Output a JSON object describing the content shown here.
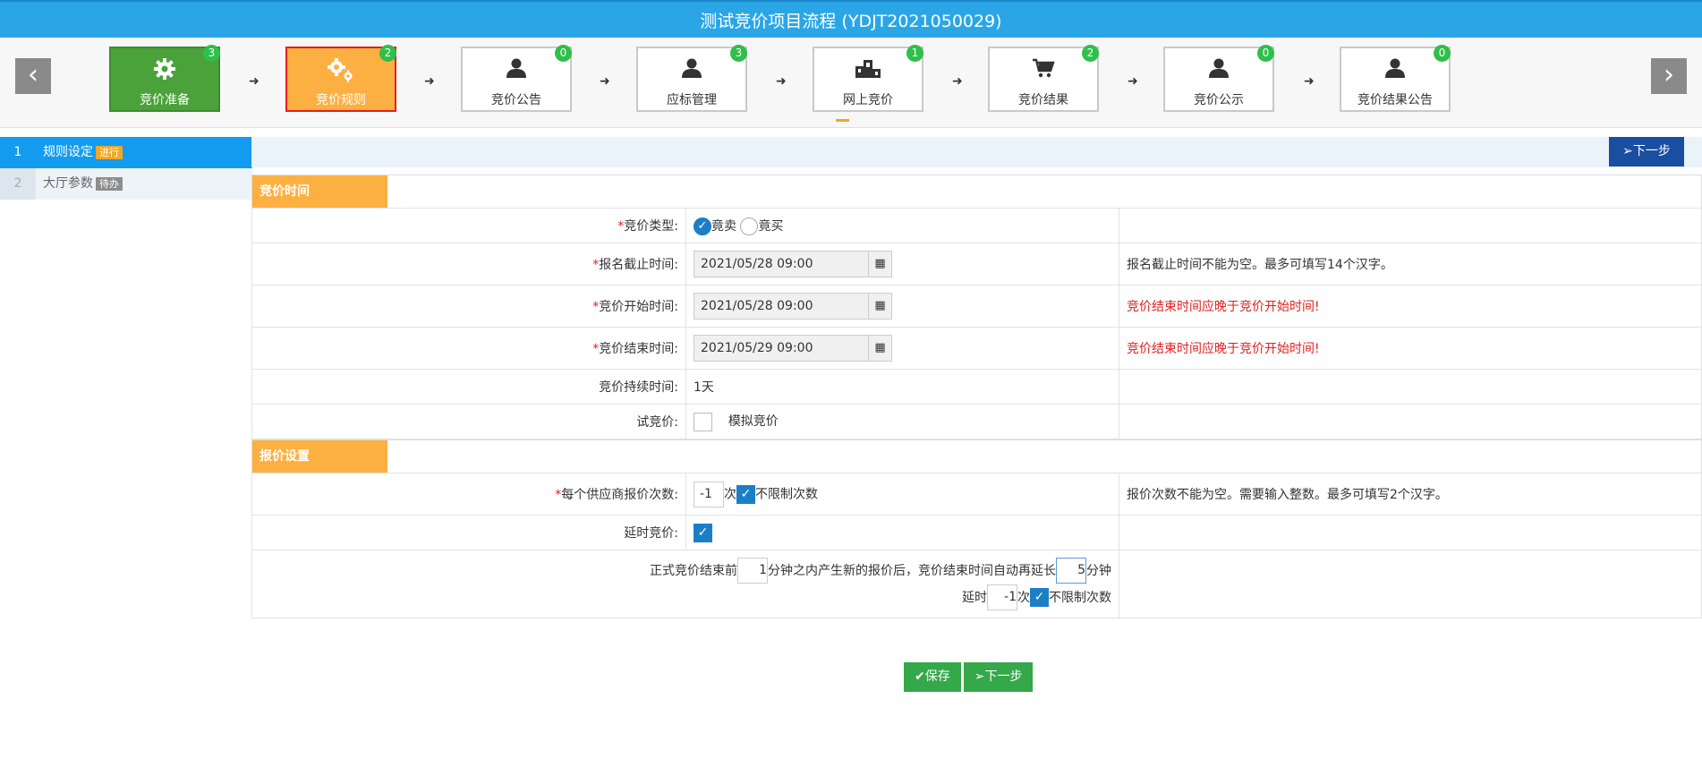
{
  "header": {
    "title": "测试竞价项目流程 (YDJT2021050029)"
  },
  "steps": [
    {
      "label": "竞价准备",
      "count": "3",
      "icon": "gear-icon",
      "state": "done"
    },
    {
      "label": "竞价规则",
      "count": "2",
      "icon": "gears-icon",
      "state": "active"
    },
    {
      "label": "竞价公告",
      "count": "0",
      "icon": "user-icon",
      "state": "normal"
    },
    {
      "label": "应标管理",
      "count": "3",
      "icon": "user-icon",
      "state": "normal"
    },
    {
      "label": "网上竞价",
      "count": "1",
      "icon": "podium-icon",
      "state": "normal"
    },
    {
      "label": "竞价结果",
      "count": "2",
      "icon": "cart-icon",
      "state": "normal"
    },
    {
      "label": "竞价公示",
      "count": "0",
      "icon": "user-icon",
      "state": "normal"
    },
    {
      "label": "竞价结果公告",
      "count": "0",
      "icon": "user-icon",
      "state": "normal"
    }
  ],
  "sidenav": [
    {
      "num": "1",
      "label": "规则设定",
      "tag": "进行"
    },
    {
      "num": "2",
      "label": "大厅参数",
      "tag": "待办"
    }
  ],
  "toolbar": {
    "next": "下一步"
  },
  "section1": {
    "title": "竞价时间"
  },
  "section2": {
    "title": "报价设置"
  },
  "form": {
    "type_label": "竞价类型:",
    "type_opt1": "竟卖",
    "type_opt2": "竟买",
    "signup_label": "报名截止时间:",
    "signup_value": "2021/05/28 09:00",
    "signup_note": "报名截止时间不能为空。最多可填写14个汉字。",
    "start_label": "竞价开始时间:",
    "start_value": "2021/05/28 09:00",
    "start_note": "竞价结束时间应晚于竞价开始时间!",
    "end_label": "竞价结束时间:",
    "end_value": "2021/05/29 09:00",
    "end_note": "竞价结束时间应晚于竞价开始时间!",
    "duration_label": "竞价持续时间:",
    "duration_value": "1天",
    "trial_label": "试竞价:",
    "trial_option": "模拟竞价",
    "quote_label": "每个供应商报价次数:",
    "quote_value": "-1",
    "quote_unit": "次",
    "quote_unlimited": "不限制次数",
    "quote_note": "报价次数不能为空。需要输入整数。最多可填写2个汉字。",
    "delay_label": "延时竞价:",
    "delay_text1": "正式竞价结束前",
    "delay_minutes_before": "1",
    "delay_text2": "分钟之内产生新的报价后，竞价结束时间自动再延长",
    "delay_extend": "5",
    "delay_text3": "分钟",
    "delay_times_label": "延时",
    "delay_times_value": "-1",
    "delay_times_unit": "次",
    "delay_unlimited": "不限制次数"
  },
  "footer": {
    "save": "保存",
    "next": "下一步"
  },
  "colors": {
    "header": "#2aa6e6",
    "done": "#4ca23a",
    "active": "#fdb042",
    "badge": "#2fbf4a",
    "navActive": "#139bf0",
    "nextBtn": "#1a4ea0",
    "section": "#fdb042",
    "green": "#35a84a",
    "error": "#e02020"
  }
}
